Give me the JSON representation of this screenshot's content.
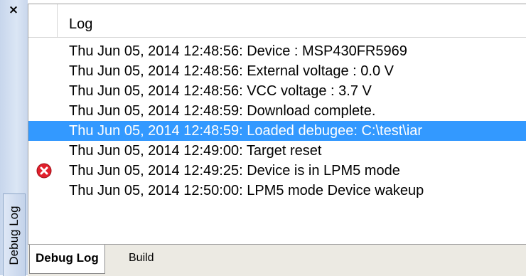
{
  "window": {
    "close_glyph": "×"
  },
  "side_tab": {
    "label": "Debug Log"
  },
  "log": {
    "header": "Log",
    "rows": [
      {
        "text": "Thu Jun 05, 2014 12:48:56: Device : MSP430FR5969",
        "selected": false,
        "icon": ""
      },
      {
        "text": "Thu Jun 05, 2014 12:48:56: External voltage : 0.0 V",
        "selected": false,
        "icon": ""
      },
      {
        "text": "Thu Jun 05, 2014 12:48:56: VCC voltage : 3.7 V",
        "selected": false,
        "icon": ""
      },
      {
        "text": "Thu Jun 05, 2014 12:48:59: Download complete.",
        "selected": false,
        "icon": ""
      },
      {
        "text": "Thu Jun 05, 2014 12:48:59: Loaded debugee: C:\\test\\iar",
        "selected": true,
        "icon": ""
      },
      {
        "text": "Thu Jun 05, 2014 12:49:00: Target reset",
        "selected": false,
        "icon": ""
      },
      {
        "text": "Thu Jun 05, 2014 12:49:25: Device is in LPM5 mode",
        "selected": false,
        "icon": "error-icon"
      },
      {
        "text": "Thu Jun 05, 2014 12:50:00: LPM5 mode Device wakeup",
        "selected": false,
        "icon": ""
      }
    ]
  },
  "tabs": [
    {
      "label": "Debug Log",
      "active": true
    },
    {
      "label": "Build",
      "active": false
    }
  ],
  "colors": {
    "selection": "#3399ff",
    "error": "#e2202c",
    "side_strip": "#c7d6ec"
  }
}
